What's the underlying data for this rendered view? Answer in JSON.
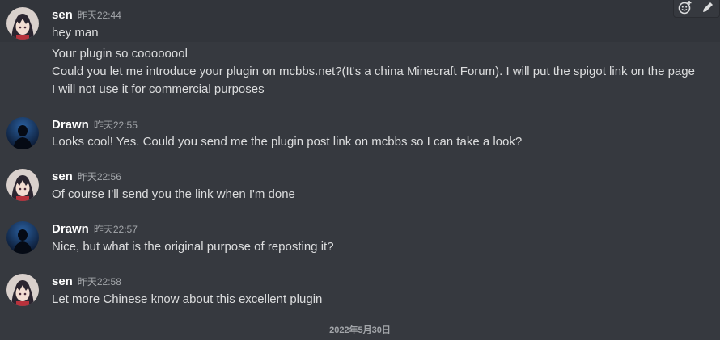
{
  "toolbar": {
    "icons": [
      "add-reaction-icon",
      "edit-icon"
    ]
  },
  "messages": [
    {
      "author": "sen",
      "timestamp": "昨天22:44",
      "avatar": "anime-girl-avatar",
      "lines": [
        "hey man",
        "Your plugin so coooooool",
        "Could you let me introduce your plugin on mcbbs.net?(It's a china Minecraft Forum). I will put the spigot link on the page",
        "I will not use it for commercial purposes"
      ]
    },
    {
      "author": "Drawn",
      "timestamp": "昨天22:55",
      "avatar": "dark-silhouette-avatar",
      "lines": [
        "Looks cool! Yes. Could you send me the plugin post link on mcbbs so I can take a look?"
      ]
    },
    {
      "author": "sen",
      "timestamp": "昨天22:56",
      "avatar": "anime-girl-avatar",
      "lines": [
        "Of course I'll send you the link when I'm done"
      ]
    },
    {
      "author": "Drawn",
      "timestamp": "昨天22:57",
      "avatar": "dark-silhouette-avatar",
      "lines": [
        "Nice, but what is the original purpose of reposting it?"
      ]
    },
    {
      "author": "sen",
      "timestamp": "昨天22:58",
      "avatar": "anime-girl-avatar",
      "lines": [
        "Let more Chinese know about this excellent plugin"
      ]
    }
  ],
  "date_divider": "2022年5月30日",
  "colors": {
    "background": "#36393f",
    "username": "#ffffff",
    "text": "#dcddde",
    "timestamp": "#a3a6aa"
  }
}
